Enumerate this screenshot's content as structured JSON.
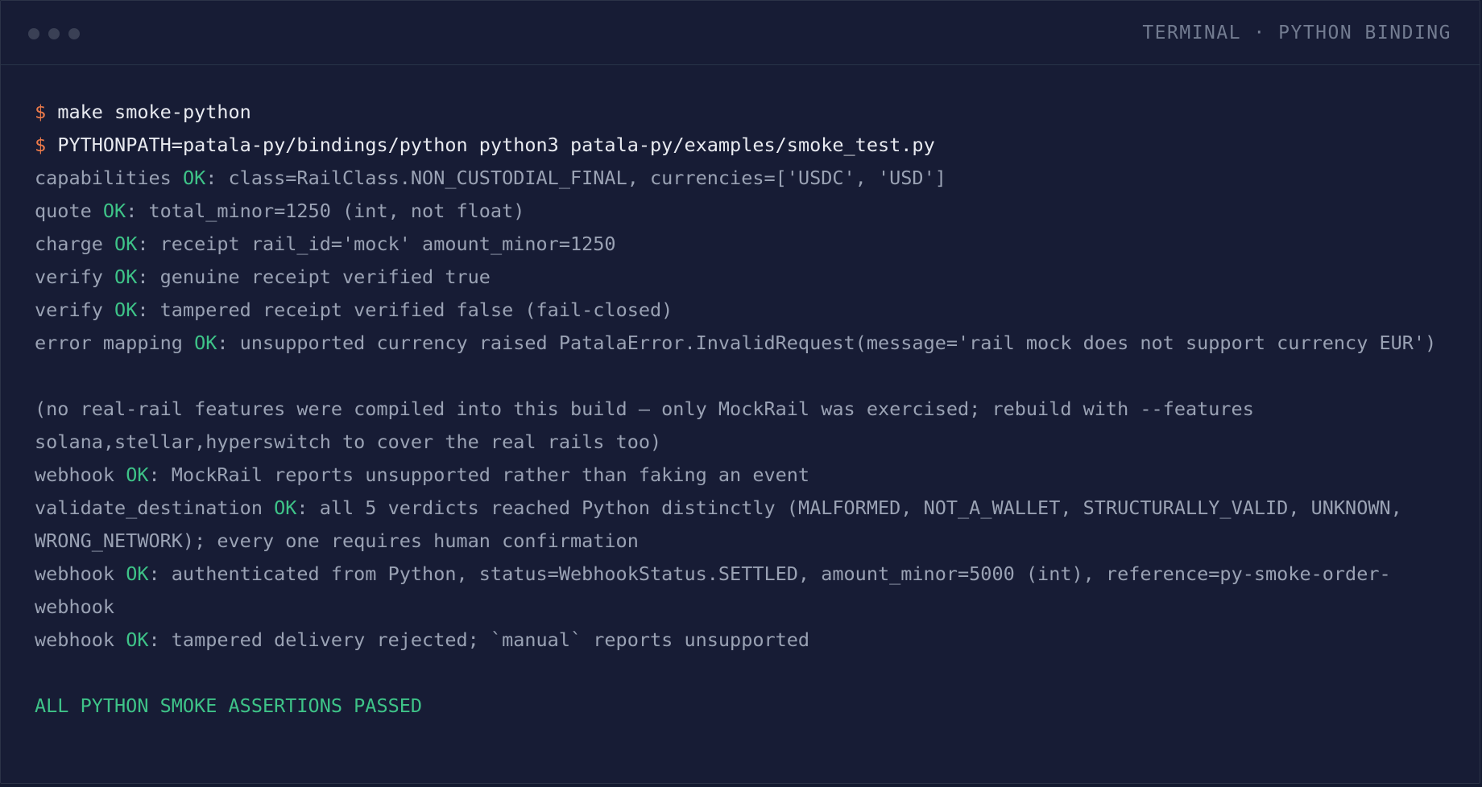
{
  "window": {
    "title": "TERMINAL · PYTHON BINDING"
  },
  "terminal": {
    "prompt_symbol": "$",
    "commands": [
      "make smoke-python",
      "PYTHONPATH=patala-py/bindings/python python3 patala-py/examples/smoke_test.py"
    ],
    "ok_token": "OK",
    "results": [
      {
        "prefix": "capabilities ",
        "suffix": ": class=RailClass.NON_CUSTODIAL_FINAL, currencies=['USDC', 'USD']"
      },
      {
        "prefix": "quote ",
        "suffix": ": total_minor=1250 (int, not float)"
      },
      {
        "prefix": "charge ",
        "suffix": ": receipt rail_id='mock' amount_minor=1250"
      },
      {
        "prefix": "verify ",
        "suffix": ": genuine receipt verified true"
      },
      {
        "prefix": "verify ",
        "suffix": ": tampered receipt verified false (fail-closed)"
      },
      {
        "prefix": "error mapping ",
        "suffix": ": unsupported currency raised PatalaError.InvalidRequest(message='rail mock does not support currency EUR')"
      }
    ],
    "note": "(no real-rail features were compiled into this build — only MockRail was exercised; rebuild with --features solana,stellar,hyperswitch to cover the real rails too)",
    "results_after": [
      {
        "prefix": "webhook ",
        "suffix": ": MockRail reports unsupported rather than faking an event"
      },
      {
        "prefix": "validate_destination ",
        "suffix": ": all 5 verdicts reached Python distinctly (MALFORMED, NOT_A_WALLET, STRUCTURALLY_VALID, UNKNOWN, WRONG_NETWORK); every one requires human confirmation"
      },
      {
        "prefix": "webhook ",
        "suffix": ": authenticated from Python, status=WebhookStatus.SETTLED, amount_minor=5000 (int), reference=py-smoke-order-webhook"
      },
      {
        "prefix": "webhook ",
        "suffix": ": tampered delivery rejected; `manual` reports unsupported"
      }
    ],
    "summary": "ALL PYTHON SMOKE ASSERTIONS PASSED"
  },
  "colors": {
    "background": "#171c35",
    "prompt": "#ec7a4a",
    "ok": "#3ec388",
    "text": "#9aa2b4",
    "command": "#e8eaf0"
  }
}
